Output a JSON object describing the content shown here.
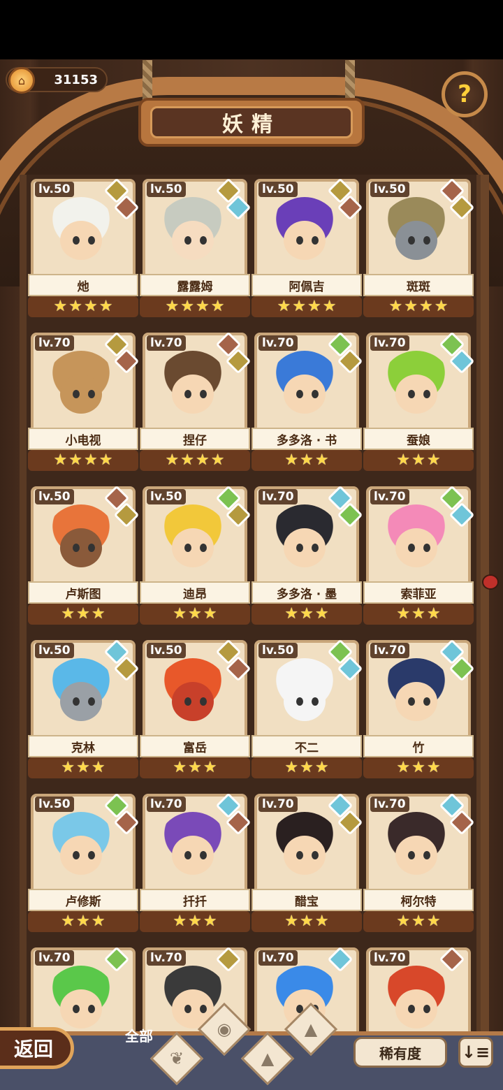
{
  "header": {
    "coins": "31153",
    "title": "妖精",
    "help_symbol": "?"
  },
  "icons": {
    "coin": "house-coin-icon",
    "help": "question-sprout-icon",
    "elements": [
      "earth",
      "water",
      "plant"
    ]
  },
  "colors": {
    "earth": "#b59a3f",
    "water": "#6fc5d9",
    "plant": "#7cc251",
    "rock": "#a5644a"
  },
  "fairies": [
    {
      "level": "lv.50",
      "name": "灺",
      "stars": 4,
      "badges": [
        "earth",
        "rock"
      ],
      "hair": "#f2f2ec",
      "skin": "#f6d7b4"
    },
    {
      "level": "lv.50",
      "name": "露露姆",
      "stars": 4,
      "badges": [
        "earth",
        "water"
      ],
      "hair": "#c7cbc0",
      "skin": "#f6dcc0"
    },
    {
      "level": "lv.50",
      "name": "阿佩吉",
      "stars": 4,
      "badges": [
        "earth",
        "rock"
      ],
      "hair": "#6a3fb8",
      "skin": "#f6d7b4"
    },
    {
      "level": "lv.50",
      "name": "斑斑",
      "stars": 4,
      "badges": [
        "rock",
        "earth"
      ],
      "hair": "#9a8a5a",
      "skin": "#8a9096"
    },
    {
      "level": "lv.70",
      "name": "小电视",
      "stars": 4,
      "badges": [
        "earth",
        "rock"
      ],
      "hair": "#c6955a",
      "skin": "#c6955a"
    },
    {
      "level": "lv.70",
      "name": "捏仔",
      "stars": 4,
      "badges": [
        "rock",
        "earth"
      ],
      "hair": "#6a4a30",
      "skin": "#f6d7b4"
    },
    {
      "level": "lv.70",
      "name": "多多洛 · 书",
      "stars": 3,
      "badges": [
        "plant",
        "earth"
      ],
      "hair": "#3a7ad8",
      "skin": "#f6d7b4"
    },
    {
      "level": "lv.70",
      "name": "蚕娘",
      "stars": 3,
      "badges": [
        "plant",
        "water"
      ],
      "hair": "#8ccf3a",
      "skin": "#f6d7b4"
    },
    {
      "level": "lv.50",
      "name": "卢斯图",
      "stars": 3,
      "badges": [
        "rock",
        "earth"
      ],
      "hair": "#e8743a",
      "skin": "#8a5a3a"
    },
    {
      "level": "lv.50",
      "name": "迪昂",
      "stars": 3,
      "badges": [
        "plant",
        "earth"
      ],
      "hair": "#f2c83a",
      "skin": "#f6d7b4"
    },
    {
      "level": "lv.70",
      "name": "多多洛 · 墨",
      "stars": 3,
      "badges": [
        "water",
        "plant"
      ],
      "hair": "#2a2a30",
      "skin": "#f6d7b4"
    },
    {
      "level": "lv.70",
      "name": "索菲亚",
      "stars": 3,
      "badges": [
        "plant",
        "water"
      ],
      "hair": "#f48ab8",
      "skin": "#f6d7b4"
    },
    {
      "level": "lv.50",
      "name": "克林",
      "stars": 3,
      "badges": [
        "water",
        "earth"
      ],
      "hair": "#5ab8e8",
      "skin": "#9aa0a6"
    },
    {
      "level": "lv.50",
      "name": "富岳",
      "stars": 3,
      "badges": [
        "earth",
        "rock"
      ],
      "hair": "#e8582a",
      "skin": "#c8402a"
    },
    {
      "level": "lv.50",
      "name": "不二",
      "stars": 3,
      "badges": [
        "plant",
        "water"
      ],
      "hair": "#f5f5f5",
      "skin": "#f5f5f5"
    },
    {
      "level": "lv.70",
      "name": "竹",
      "stars": 3,
      "badges": [
        "water",
        "plant"
      ],
      "hair": "#2a3a6a",
      "skin": "#f6d7b4"
    },
    {
      "level": "lv.50",
      "name": "卢修斯",
      "stars": 3,
      "badges": [
        "plant",
        "rock"
      ],
      "hair": "#7ac8e8",
      "skin": "#f6d7b4"
    },
    {
      "level": "lv.70",
      "name": "扦扦",
      "stars": 3,
      "badges": [
        "water",
        "rock"
      ],
      "hair": "#7a4ab8",
      "skin": "#f6d7b4"
    },
    {
      "level": "lv.70",
      "name": "醋宝",
      "stars": 3,
      "badges": [
        "water",
        "earth"
      ],
      "hair": "#2a2020",
      "skin": "#f6d7b4"
    },
    {
      "level": "lv.70",
      "name": "柯尔特",
      "stars": 3,
      "badges": [
        "water",
        "rock"
      ],
      "hair": "#3a2a2a",
      "skin": "#f6d7b4"
    },
    {
      "level": "lv.70",
      "name": "",
      "stars": 0,
      "badges": [
        "plant"
      ],
      "hair": "#5ac84a",
      "skin": "#f6d7b4"
    },
    {
      "level": "lv.70",
      "name": "",
      "stars": 0,
      "badges": [
        "earth"
      ],
      "hair": "#3a3a3a",
      "skin": "#f6d7b4"
    },
    {
      "level": "lv.70",
      "name": "",
      "stars": 0,
      "badges": [
        "water"
      ],
      "hair": "#3a8ae8",
      "skin": "#f6d7b4"
    },
    {
      "level": "lv.70",
      "name": "",
      "stars": 0,
      "badges": [
        "rock"
      ],
      "hair": "#d8482a",
      "skin": "#f6d7b4"
    }
  ],
  "footer": {
    "back_label": "返回",
    "filter_all_label": "全部",
    "sort_label": "稀有度",
    "order_symbol": "↓≡"
  }
}
